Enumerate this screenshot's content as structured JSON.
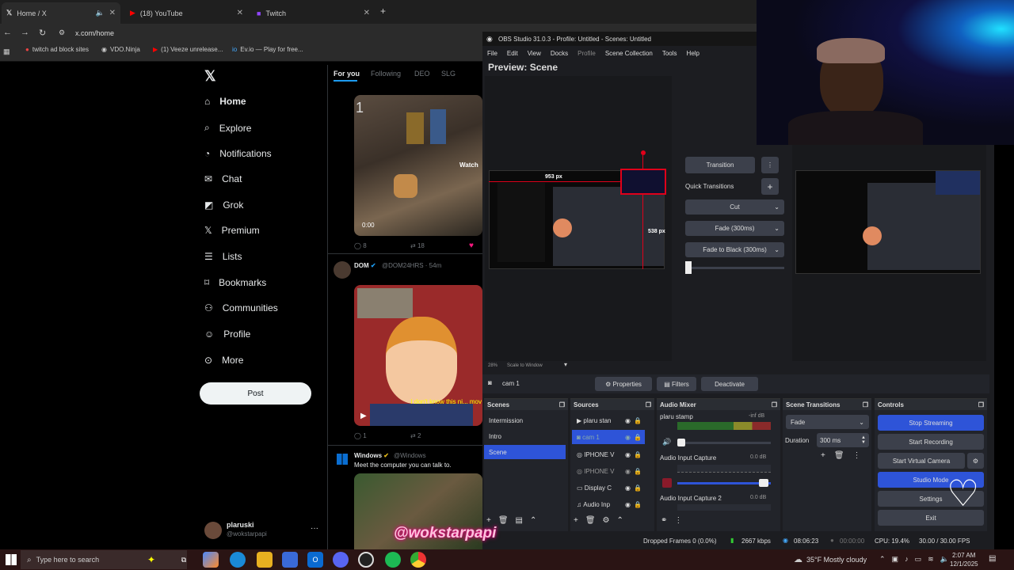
{
  "browser": {
    "tabs": [
      {
        "label": "Home / X"
      },
      {
        "label": "(18) YouTube"
      },
      {
        "label": "Twitch"
      }
    ],
    "url": "x.com/home",
    "bookmarks": [
      "twitch ad block sites",
      "VDO.Ninja",
      "(1) Veeze unrelease...",
      "Ev.io — Play for free..."
    ]
  },
  "x": {
    "nav": [
      "Home",
      "Explore",
      "Notifications",
      "Chat",
      "Grok",
      "Premium",
      "Lists",
      "Bookmarks",
      "Communities",
      "Profile",
      "More"
    ],
    "post_label": "Post",
    "feed_tabs": [
      "For you",
      "Following",
      "DEO",
      "SLG"
    ],
    "user": {
      "name": "plaruski",
      "handle": "@wokstarpapi"
    },
    "tweets": [
      {
        "rank": "1",
        "watch": "Watch",
        "duration": "0:00",
        "replies": "8",
        "retweets": "18"
      },
      {
        "author": "DOM",
        "handle": "@DOM24HRS · 54m",
        "replies": "1",
        "retweets": "2",
        "caption": "I don't know this ni... mov"
      },
      {
        "author": "Windows",
        "handle": "@Windows",
        "text": "Meet the computer you can talk to."
      }
    ]
  },
  "obs": {
    "title": "OBS Studio 31.0.3 - Profile: Untitled - Scenes: Untitled",
    "menu": [
      "File",
      "Edit",
      "View",
      "Docks",
      "Profile",
      "Scene Collection",
      "Tools",
      "Help"
    ],
    "preview_title": "Preview: Scene",
    "dims": {
      "w": "953 px",
      "h": "538 px"
    },
    "transition_label": "Transition",
    "quick_transitions": "Quick Transitions",
    "quick_list": [
      "Cut",
      "Fade (300ms)",
      "Fade to Black (300ms)"
    ],
    "zoom": "28%",
    "zoom_mode": "Scale to Window",
    "source_name": "cam 1",
    "properties": "Properties",
    "filters": "Filters",
    "deactivate": "Deactivate",
    "scenes_header": "Scenes",
    "scenes": [
      "Intermission",
      "Intro",
      "Scene"
    ],
    "sources_header": "Sources",
    "sources": [
      "plaru stan",
      "cam 1",
      "IPHONE V",
      "IPHONE V",
      "Display C",
      "Audio Inp"
    ],
    "mixer_header": "Audio Mixer",
    "mixer": [
      {
        "name": "plaru stamp",
        "db": "-inf dB"
      },
      {
        "name": "Audio Input Capture",
        "db": "0.0 dB"
      },
      {
        "name": "Audio Input Capture 2",
        "db": "0.0 dB"
      }
    ],
    "transitions_header": "Scene Transitions",
    "transition_select": "Fade",
    "duration_label": "Duration",
    "duration_value": "300 ms",
    "controls_header": "Controls",
    "controls": [
      "Stop Streaming",
      "Start Recording",
      "Start Virtual Camera",
      "Studio Mode",
      "Settings",
      "Exit"
    ],
    "status": {
      "dropped": "Dropped Frames 0 (0.0%)",
      "bitrate": "2667 kbps",
      "stream_time": "08:06:23",
      "rec_time": "00:00:00",
      "cpu": "CPU: 19.4%",
      "fps": "30.00 / 30.00 FPS"
    }
  },
  "overlay": {
    "watermark": "@wokstarpapi"
  },
  "taskbar": {
    "search_placeholder": "Type here to search",
    "weather": "35°F  Mostly cloudy",
    "time": "2:07 AM",
    "date": "12/1/2025"
  },
  "colors": {
    "obs_blue": "#2e54d8",
    "x_bg": "#000000",
    "taskbar": "#2a1414",
    "accent_red": "#e0001a"
  }
}
